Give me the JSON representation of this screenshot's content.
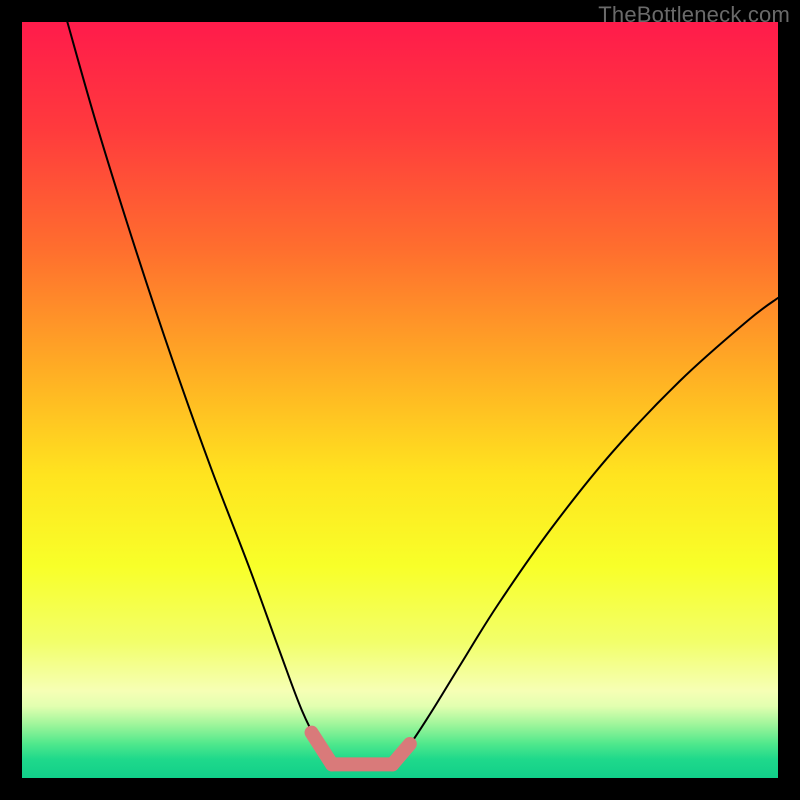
{
  "watermark": "TheBottleneck.com",
  "chart_data": {
    "type": "line",
    "title": "",
    "xlabel": "",
    "ylabel": "",
    "xlim": [
      0,
      100
    ],
    "ylim": [
      0,
      100
    ],
    "grid": false,
    "legend": false,
    "annotations": [],
    "series": [
      {
        "name": "left-curve",
        "x": [
          6,
          10,
          15,
          20,
          25,
          30,
          34,
          37,
          39.5,
          41
        ],
        "values": [
          100,
          86,
          70,
          55,
          41,
          28,
          17,
          9,
          4,
          2
        ],
        "stroke": "#000000"
      },
      {
        "name": "right-curve",
        "x": [
          49,
          51,
          54,
          58,
          63,
          70,
          78,
          87,
          96,
          100
        ],
        "values": [
          2,
          4,
          8.5,
          15,
          23,
          33,
          43,
          52.5,
          60.5,
          63.5
        ],
        "stroke": "#000000"
      },
      {
        "name": "left-highlight",
        "x": [
          38.3,
          41.0
        ],
        "values": [
          6.0,
          1.8
        ],
        "stroke": "#d97a7a",
        "thick": true
      },
      {
        "name": "bottom-highlight",
        "x": [
          41.0,
          49.0
        ],
        "values": [
          1.8,
          1.8
        ],
        "stroke": "#d97a7a",
        "thick": true
      },
      {
        "name": "right-highlight",
        "x": [
          49.0,
          51.3
        ],
        "values": [
          1.8,
          4.5
        ],
        "stroke": "#d97a7a",
        "thick": true
      }
    ],
    "gradient": {
      "stops": [
        {
          "offset": 0.0,
          "color": "#ff1b4b"
        },
        {
          "offset": 0.14,
          "color": "#ff3a3d"
        },
        {
          "offset": 0.3,
          "color": "#ff6e2e"
        },
        {
          "offset": 0.46,
          "color": "#ffad24"
        },
        {
          "offset": 0.6,
          "color": "#ffe41f"
        },
        {
          "offset": 0.72,
          "color": "#f8ff29"
        },
        {
          "offset": 0.82,
          "color": "#f2ff6a"
        },
        {
          "offset": 0.885,
          "color": "#f6ffb5"
        },
        {
          "offset": 0.905,
          "color": "#e2ffb0"
        },
        {
          "offset": 0.93,
          "color": "#9cf59a"
        },
        {
          "offset": 0.955,
          "color": "#4fe88c"
        },
        {
          "offset": 0.975,
          "color": "#1fd98b"
        },
        {
          "offset": 1.0,
          "color": "#11cf8a"
        }
      ]
    }
  }
}
